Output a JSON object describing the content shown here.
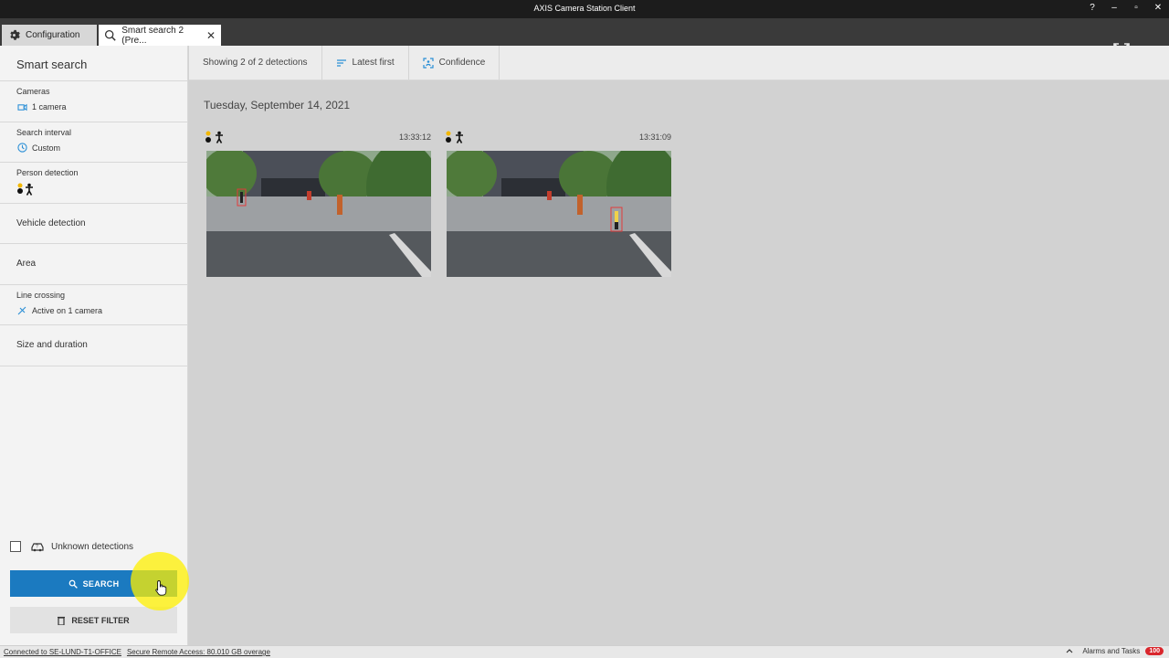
{
  "window": {
    "title": "AXIS Camera Station Client",
    "help": "?",
    "minimize": "–",
    "restore": "▫",
    "close": "✕"
  },
  "tabs": [
    {
      "label": "Configuration",
      "icon": "gear-icon"
    },
    {
      "label": "Smart search 2 (Pre...",
      "icon": "search-icon",
      "close": "✕"
    }
  ],
  "add_tab": "+",
  "sidebar": {
    "title": "Smart search",
    "filters": {
      "cameras": {
        "label": "Cameras",
        "value": "1 camera"
      },
      "interval": {
        "label": "Search interval",
        "value": "Custom"
      },
      "person": {
        "label": "Person detection"
      },
      "vehicle": {
        "label": "Vehicle detection"
      },
      "area": {
        "label": "Area"
      },
      "line": {
        "label": "Line crossing",
        "value": "Active on 1 camera"
      },
      "size": {
        "label": "Size and duration"
      }
    },
    "unknown_label": "Unknown detections",
    "search_label": "SEARCH",
    "reset_label": "RESET FILTER"
  },
  "toolbar": {
    "showing": "Showing 2 of 2 detections",
    "sort": "Latest first",
    "confidence": "Confidence"
  },
  "results": {
    "date": "Tuesday, September 14, 2021",
    "cards": [
      {
        "time": "13:33:12"
      },
      {
        "time": "13:31:09"
      }
    ]
  },
  "status": {
    "connected": "Connected to SE-LUND-T1-OFFICE",
    "remote": "Secure Remote Access: 80.010 GB overage",
    "alarms": "Alarms and Tasks",
    "alarm_count": "100"
  },
  "colors": {
    "accent": "#1b7ac0",
    "alarm": "#d9262c",
    "highlight": "#fff000"
  }
}
